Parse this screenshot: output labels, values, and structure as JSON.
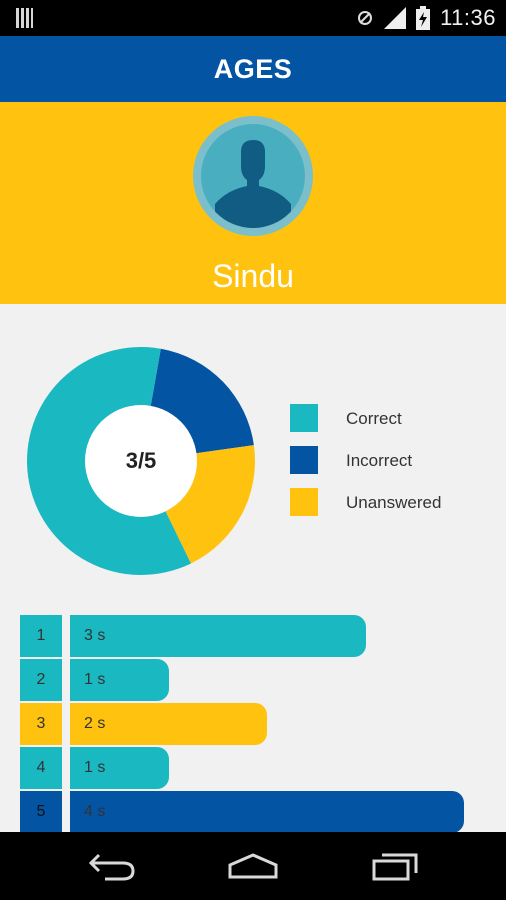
{
  "status_bar": {
    "time": "11:36",
    "icons": [
      "notification-grid-icon",
      "sync-icon",
      "signal-icon",
      "battery-charging-icon"
    ]
  },
  "app_bar": {
    "title": "AGES"
  },
  "profile": {
    "name": "Sindu",
    "avatar_icon": "user-silhouette-icon"
  },
  "score": {
    "center_label": "3/5",
    "segments": [
      {
        "key": "correct",
        "count": 3
      },
      {
        "key": "incorrect",
        "count": 1
      },
      {
        "key": "unanswered",
        "count": 1
      }
    ]
  },
  "legend": [
    {
      "key": "correct",
      "label": "Correct",
      "color": "#1ab8c1"
    },
    {
      "key": "incorrect",
      "label": "Incorrect",
      "color": "#0454a4"
    },
    {
      "key": "unanswered",
      "label": "Unanswered",
      "color": "#ffc20e"
    }
  ],
  "questions": [
    {
      "number": "1",
      "time_label": "3 s",
      "seconds": 3,
      "status": "correct"
    },
    {
      "number": "2",
      "time_label": "1 s",
      "seconds": 1,
      "status": "correct"
    },
    {
      "number": "3",
      "time_label": "2 s",
      "seconds": 2,
      "status": "unanswered"
    },
    {
      "number": "4",
      "time_label": "1 s",
      "seconds": 1,
      "status": "correct"
    },
    {
      "number": "5",
      "time_label": "4 s",
      "seconds": 4,
      "status": "incorrect"
    }
  ],
  "colors": {
    "correct": "#1ab8c1",
    "incorrect": "#0454a4",
    "unanswered": "#ffc20e",
    "header": "#0454a4",
    "profile_bg": "#ffc20e"
  },
  "nav_bar": {
    "icons": [
      "back-icon",
      "home-icon",
      "recent-apps-icon"
    ]
  }
}
